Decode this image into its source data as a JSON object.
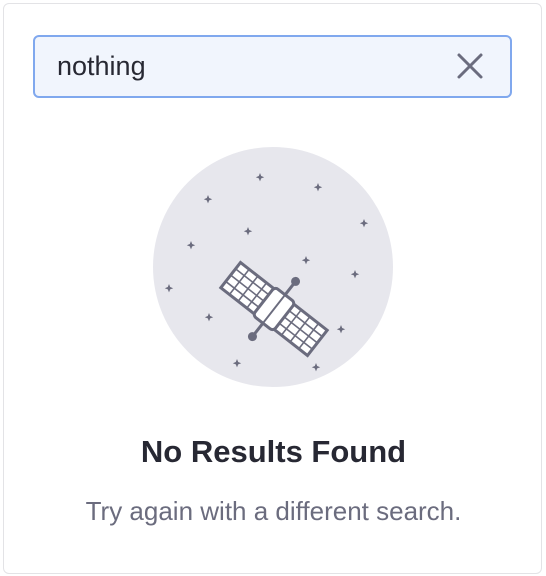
{
  "search": {
    "value": "nothing",
    "clear_icon": "close-icon"
  },
  "empty_state": {
    "illustration_icon": "satellite-icon",
    "title": "No Results Found",
    "message": "Try again with a different search."
  },
  "colors": {
    "input_border": "#80a8ee",
    "input_background": "#f1f5fd",
    "illustration_circle": "#e7e7ed",
    "illustration_stroke": "#6b6c7e",
    "title": "#272833",
    "message": "#6b6c7e"
  }
}
